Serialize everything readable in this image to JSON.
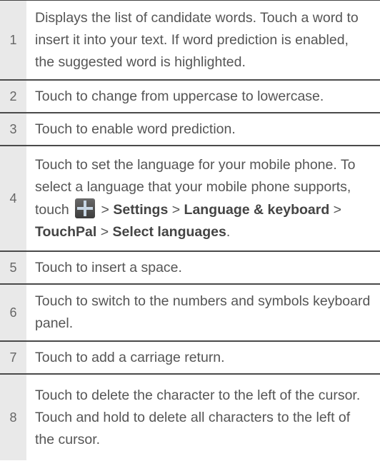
{
  "rows": [
    {
      "num": "1",
      "text": "Displays the list of candidate words. Touch a word to insert it into your text. If word prediction is enabled, the suggested word is highlighted."
    },
    {
      "num": "2",
      "text": "Touch to change from uppercase to lowercase."
    },
    {
      "num": "3",
      "text": "Touch to enable word prediction."
    },
    {
      "num": "4",
      "parts": {
        "before": "Touch to set the language for your mobile phone. To select a language that your mobile phone supports, touch",
        "sep1": " > ",
        "settings": "Settings",
        "sep2": " > ",
        "language_keyboard": "Language & keyboard",
        "sep3": " > ",
        "touchpal": "TouchPal",
        "sep4": " > ",
        "select_languages": "Select languages",
        "end": "."
      },
      "icon": "menu-icon"
    },
    {
      "num": "5",
      "text": "Touch to insert a space."
    },
    {
      "num": "6",
      "text": "Touch to switch to the numbers and symbols keyboard panel."
    },
    {
      "num": "7",
      "text": "Touch to add a carriage return."
    },
    {
      "num": "8",
      "text": "Touch to delete the character to the left of the cursor. Touch and hold to delete all characters to the left of the cursor."
    }
  ]
}
